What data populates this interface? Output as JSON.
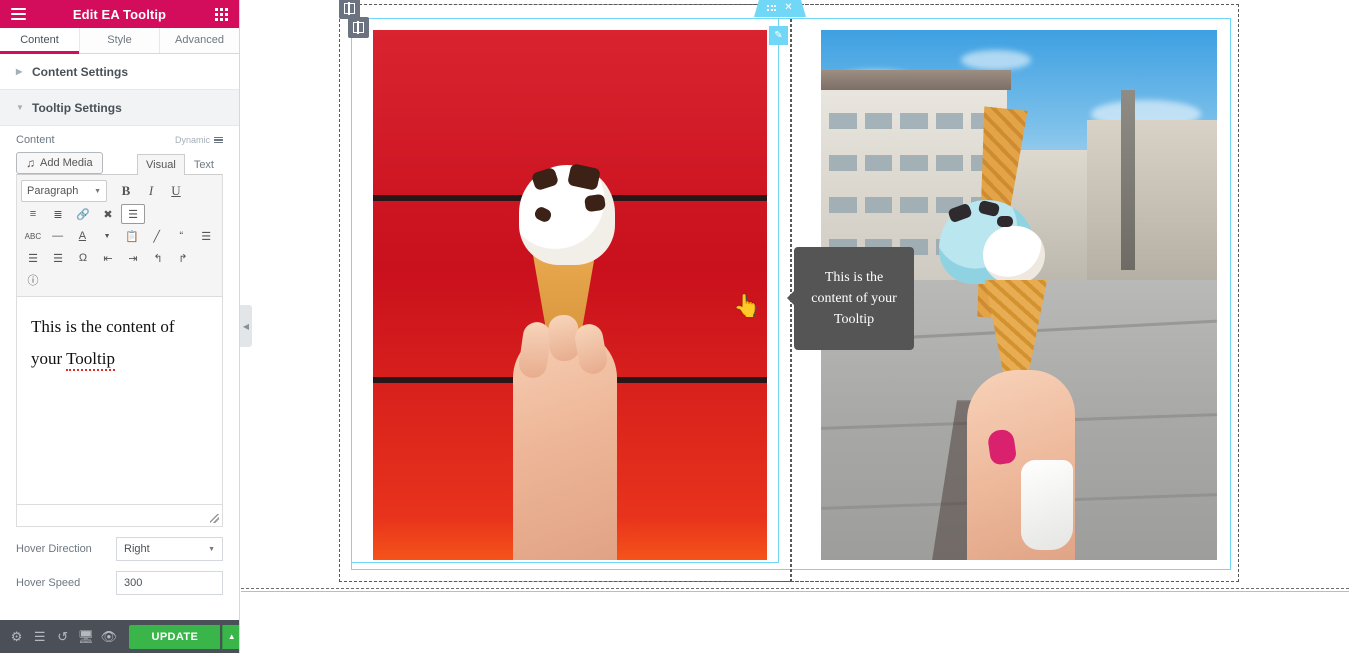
{
  "panel": {
    "header": {
      "title": "Edit EA Tooltip",
      "menu_icon": "hamburger-icon",
      "grid_icon": "grid-icon"
    },
    "tabs": [
      {
        "label": "Content",
        "active": true
      },
      {
        "label": "Style",
        "active": false
      },
      {
        "label": "Advanced",
        "active": false
      }
    ],
    "sections": [
      {
        "label": "Content Settings",
        "open": false
      },
      {
        "label": "Tooltip Settings",
        "open": true
      }
    ],
    "content_control": {
      "label": "Content",
      "dynamic_label": "Dynamic"
    },
    "editor": {
      "add_media_label": "Add Media",
      "mode_tabs": [
        {
          "label": "Visual",
          "active": true
        },
        {
          "label": "Text",
          "active": false
        }
      ],
      "format_select": "Paragraph",
      "toolbar_row1": [
        "B",
        "I",
        "U"
      ],
      "toolbar_row2_icons": [
        "bullet-list-icon",
        "numbered-list-icon",
        "link-icon",
        "more-toolbar-icon",
        "blockquote-block-icon"
      ],
      "toolbar_row3_icons": [
        "strikethrough-icon",
        "horizontal-rule-icon",
        "text-color-icon",
        "color-dropdown-icon",
        "paste-text-icon",
        "clear-formatting-icon",
        "blockquote-icon",
        "align-left-icon"
      ],
      "toolbar_row4_icons": [
        "align-center-icon",
        "align-right-icon",
        "special-character-icon",
        "outdent-icon",
        "indent-icon",
        "undo-icon",
        "redo-icon"
      ],
      "toolbar_row5_icons": [
        "keyboard-shortcuts-icon"
      ],
      "body_text": "This is the content of your ",
      "body_text_misspelled": "Tooltip"
    },
    "fields": [
      {
        "name": "hover-direction",
        "label": "Hover Direction",
        "type": "select",
        "value": "Right"
      },
      {
        "name": "hover-speed",
        "label": "Hover Speed",
        "type": "text",
        "value": "300"
      }
    ],
    "footer": {
      "icons": [
        "settings-gear-icon",
        "navigator-layers-icon",
        "history-revisions-icon",
        "responsive-mode-icon",
        "preview-eye-icon"
      ],
      "update_label": "UPDATE",
      "update_caret_icon": "chevron-up-icon"
    },
    "collapse_tab_icon": "chevron-left-icon"
  },
  "canvas": {
    "tooltip_text": "This is the content of your Tooltip",
    "handles": {
      "section_handle_icon": "column-handle-icon",
      "column_handle_icon": "column-handle-icon",
      "widget_tab_dots_icon": "drag-dots-icon",
      "widget_tab_close_icon": "close-icon",
      "edit_badge_icon": "pencil-icon"
    },
    "cursor_icon": "pointer-hand-cursor"
  },
  "colors": {
    "brand_pink": "#d30c5c",
    "elementor_blue": "#71d7f7",
    "update_green": "#39b54a",
    "tooltip_bg": "#555555",
    "footer_bg": "#4b4f58"
  }
}
